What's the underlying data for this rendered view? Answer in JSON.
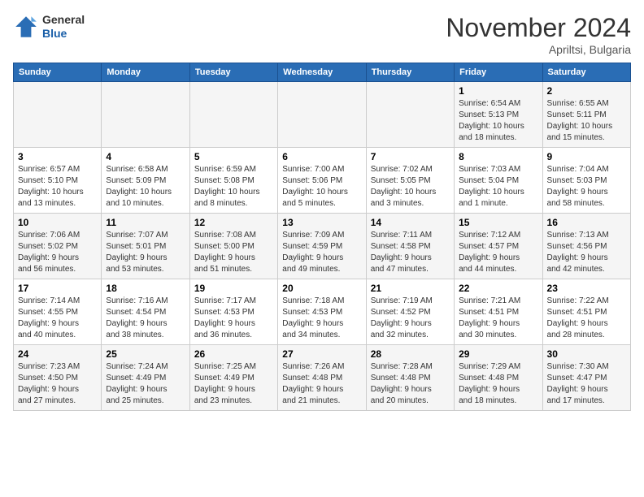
{
  "header": {
    "logo_line1": "General",
    "logo_line2": "Blue",
    "month_title": "November 2024",
    "location": "Apriltsi, Bulgaria"
  },
  "weekdays": [
    "Sunday",
    "Monday",
    "Tuesday",
    "Wednesday",
    "Thursday",
    "Friday",
    "Saturday"
  ],
  "weeks": [
    [
      {
        "day": null,
        "info": null
      },
      {
        "day": null,
        "info": null
      },
      {
        "day": null,
        "info": null
      },
      {
        "day": null,
        "info": null
      },
      {
        "day": null,
        "info": null
      },
      {
        "day": "1",
        "info": "Sunrise: 6:54 AM\nSunset: 5:13 PM\nDaylight: 10 hours\nand 18 minutes."
      },
      {
        "day": "2",
        "info": "Sunrise: 6:55 AM\nSunset: 5:11 PM\nDaylight: 10 hours\nand 15 minutes."
      }
    ],
    [
      {
        "day": "3",
        "info": "Sunrise: 6:57 AM\nSunset: 5:10 PM\nDaylight: 10 hours\nand 13 minutes."
      },
      {
        "day": "4",
        "info": "Sunrise: 6:58 AM\nSunset: 5:09 PM\nDaylight: 10 hours\nand 10 minutes."
      },
      {
        "day": "5",
        "info": "Sunrise: 6:59 AM\nSunset: 5:08 PM\nDaylight: 10 hours\nand 8 minutes."
      },
      {
        "day": "6",
        "info": "Sunrise: 7:00 AM\nSunset: 5:06 PM\nDaylight: 10 hours\nand 5 minutes."
      },
      {
        "day": "7",
        "info": "Sunrise: 7:02 AM\nSunset: 5:05 PM\nDaylight: 10 hours\nand 3 minutes."
      },
      {
        "day": "8",
        "info": "Sunrise: 7:03 AM\nSunset: 5:04 PM\nDaylight: 10 hours\nand 1 minute."
      },
      {
        "day": "9",
        "info": "Sunrise: 7:04 AM\nSunset: 5:03 PM\nDaylight: 9 hours\nand 58 minutes."
      }
    ],
    [
      {
        "day": "10",
        "info": "Sunrise: 7:06 AM\nSunset: 5:02 PM\nDaylight: 9 hours\nand 56 minutes."
      },
      {
        "day": "11",
        "info": "Sunrise: 7:07 AM\nSunset: 5:01 PM\nDaylight: 9 hours\nand 53 minutes."
      },
      {
        "day": "12",
        "info": "Sunrise: 7:08 AM\nSunset: 5:00 PM\nDaylight: 9 hours\nand 51 minutes."
      },
      {
        "day": "13",
        "info": "Sunrise: 7:09 AM\nSunset: 4:59 PM\nDaylight: 9 hours\nand 49 minutes."
      },
      {
        "day": "14",
        "info": "Sunrise: 7:11 AM\nSunset: 4:58 PM\nDaylight: 9 hours\nand 47 minutes."
      },
      {
        "day": "15",
        "info": "Sunrise: 7:12 AM\nSunset: 4:57 PM\nDaylight: 9 hours\nand 44 minutes."
      },
      {
        "day": "16",
        "info": "Sunrise: 7:13 AM\nSunset: 4:56 PM\nDaylight: 9 hours\nand 42 minutes."
      }
    ],
    [
      {
        "day": "17",
        "info": "Sunrise: 7:14 AM\nSunset: 4:55 PM\nDaylight: 9 hours\nand 40 minutes."
      },
      {
        "day": "18",
        "info": "Sunrise: 7:16 AM\nSunset: 4:54 PM\nDaylight: 9 hours\nand 38 minutes."
      },
      {
        "day": "19",
        "info": "Sunrise: 7:17 AM\nSunset: 4:53 PM\nDaylight: 9 hours\nand 36 minutes."
      },
      {
        "day": "20",
        "info": "Sunrise: 7:18 AM\nSunset: 4:53 PM\nDaylight: 9 hours\nand 34 minutes."
      },
      {
        "day": "21",
        "info": "Sunrise: 7:19 AM\nSunset: 4:52 PM\nDaylight: 9 hours\nand 32 minutes."
      },
      {
        "day": "22",
        "info": "Sunrise: 7:21 AM\nSunset: 4:51 PM\nDaylight: 9 hours\nand 30 minutes."
      },
      {
        "day": "23",
        "info": "Sunrise: 7:22 AM\nSunset: 4:51 PM\nDaylight: 9 hours\nand 28 minutes."
      }
    ],
    [
      {
        "day": "24",
        "info": "Sunrise: 7:23 AM\nSunset: 4:50 PM\nDaylight: 9 hours\nand 27 minutes."
      },
      {
        "day": "25",
        "info": "Sunrise: 7:24 AM\nSunset: 4:49 PM\nDaylight: 9 hours\nand 25 minutes."
      },
      {
        "day": "26",
        "info": "Sunrise: 7:25 AM\nSunset: 4:49 PM\nDaylight: 9 hours\nand 23 minutes."
      },
      {
        "day": "27",
        "info": "Sunrise: 7:26 AM\nSunset: 4:48 PM\nDaylight: 9 hours\nand 21 minutes."
      },
      {
        "day": "28",
        "info": "Sunrise: 7:28 AM\nSunset: 4:48 PM\nDaylight: 9 hours\nand 20 minutes."
      },
      {
        "day": "29",
        "info": "Sunrise: 7:29 AM\nSunset: 4:48 PM\nDaylight: 9 hours\nand 18 minutes."
      },
      {
        "day": "30",
        "info": "Sunrise: 7:30 AM\nSunset: 4:47 PM\nDaylight: 9 hours\nand 17 minutes."
      }
    ]
  ]
}
